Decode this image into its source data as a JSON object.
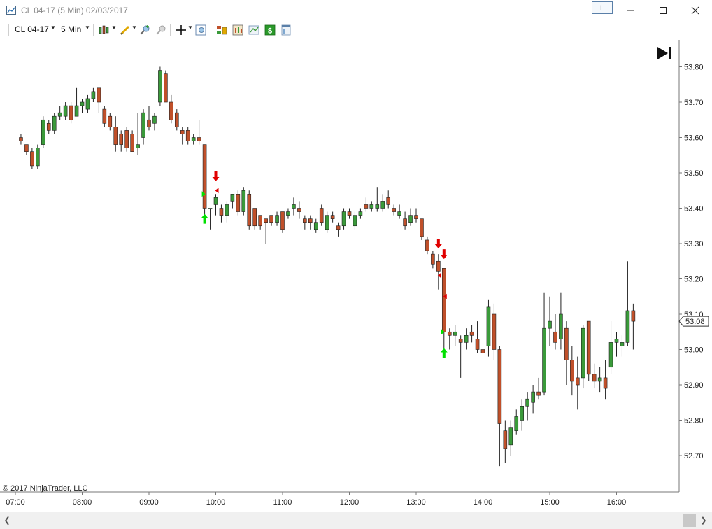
{
  "window": {
    "title": "CL 04-17 (5 Min)  02/03/2017",
    "link_button": "L"
  },
  "toolbar": {
    "instrument": "CL 04-17",
    "interval": "5 Min"
  },
  "chart": {
    "copyright": "© 2017 NinjaTrader, LLC",
    "last_price_label": "53.08",
    "colors": {
      "up": "#3a9a3a",
      "down": "#c0502a",
      "wick": "#222222",
      "buy": "#00e000",
      "sell": "#e00000"
    }
  },
  "chart_data": {
    "type": "candlestick",
    "symbol": "CL 04-17",
    "interval": "5 Min",
    "date": "02/03/2017",
    "y_ticks": [
      53.8,
      53.7,
      53.6,
      53.5,
      53.4,
      53.3,
      53.2,
      53.1,
      53.0,
      52.9,
      52.8,
      52.7
    ],
    "x_ticks": [
      "07:00",
      "08:00",
      "09:00",
      "10:00",
      "11:00",
      "12:00",
      "13:00",
      "14:00",
      "15:00",
      "16:00"
    ],
    "last_price": 53.08,
    "candles": [
      [
        "07:05",
        53.6,
        53.61,
        53.58,
        53.59
      ],
      [
        "07:10",
        53.58,
        53.58,
        53.55,
        53.56
      ],
      [
        "07:15",
        53.56,
        53.57,
        53.51,
        53.52
      ],
      [
        "07:20",
        53.52,
        53.58,
        53.51,
        53.57
      ],
      [
        "07:25",
        53.58,
        53.66,
        53.57,
        53.65
      ],
      [
        "07:30",
        53.64,
        53.65,
        53.61,
        53.62
      ],
      [
        "07:35",
        53.62,
        53.67,
        53.61,
        53.66
      ],
      [
        "07:40",
        53.66,
        53.69,
        53.65,
        53.67
      ],
      [
        "07:45",
        53.66,
        53.7,
        53.65,
        53.69
      ],
      [
        "07:50",
        53.69,
        53.7,
        53.64,
        53.65
      ],
      [
        "07:55",
        53.66,
        53.74,
        53.66,
        53.69
      ],
      [
        "08:00",
        53.69,
        53.71,
        53.67,
        53.7
      ],
      [
        "08:05",
        53.68,
        53.72,
        53.67,
        53.71
      ],
      [
        "08:10",
        53.71,
        53.74,
        53.7,
        53.73
      ],
      [
        "08:15",
        53.74,
        53.74,
        53.67,
        53.7
      ],
      [
        "08:20",
        53.68,
        53.69,
        53.63,
        53.64
      ],
      [
        "08:25",
        53.66,
        53.67,
        53.62,
        53.63
      ],
      [
        "08:30",
        53.63,
        53.66,
        53.56,
        53.58
      ],
      [
        "08:35",
        53.61,
        53.62,
        53.56,
        53.58
      ],
      [
        "08:40",
        53.62,
        53.63,
        53.56,
        53.57
      ],
      [
        "08:45",
        53.61,
        53.62,
        53.56,
        53.56
      ],
      [
        "08:50",
        53.57,
        53.67,
        53.55,
        53.58
      ],
      [
        "08:55",
        53.6,
        53.68,
        53.58,
        53.67
      ],
      [
        "09:00",
        53.65,
        53.69,
        53.62,
        53.63
      ],
      [
        "09:05",
        53.64,
        53.67,
        53.62,
        53.66
      ],
      [
        "09:10",
        53.7,
        53.8,
        53.69,
        53.79
      ],
      [
        "09:15",
        53.78,
        53.79,
        53.7,
        53.7
      ],
      [
        "09:20",
        53.7,
        53.72,
        53.64,
        53.65
      ],
      [
        "09:25",
        53.67,
        53.68,
        53.62,
        53.63
      ],
      [
        "09:30",
        53.62,
        53.63,
        53.58,
        53.61
      ],
      [
        "09:35",
        53.62,
        53.63,
        53.58,
        53.59
      ],
      [
        "09:40",
        53.59,
        53.61,
        53.58,
        53.6
      ],
      [
        "09:45",
        53.6,
        53.65,
        53.58,
        53.59
      ],
      [
        "09:50",
        53.58,
        53.58,
        53.38,
        53.4
      ],
      [
        "09:55",
        53.4,
        53.4,
        53.34,
        53.4
      ],
      [
        "10:00",
        53.41,
        53.44,
        53.38,
        53.43
      ],
      [
        "10:05",
        53.4,
        53.41,
        53.36,
        53.38
      ],
      [
        "10:10",
        53.38,
        53.42,
        53.36,
        53.41
      ],
      [
        "10:15",
        53.42,
        53.43,
        53.4,
        53.44
      ],
      [
        "10:20",
        53.44,
        53.45,
        53.38,
        53.39
      ],
      [
        "10:25",
        53.39,
        53.46,
        53.38,
        53.45
      ],
      [
        "10:30",
        53.44,
        53.45,
        53.34,
        53.35
      ],
      [
        "10:35",
        53.4,
        53.4,
        53.34,
        53.35
      ],
      [
        "10:40",
        53.38,
        53.38,
        53.34,
        53.35
      ],
      [
        "10:45",
        53.37,
        53.37,
        53.3,
        53.36
      ],
      [
        "10:50",
        53.38,
        53.38,
        53.35,
        53.36
      ],
      [
        "10:55",
        53.36,
        53.39,
        53.35,
        53.38
      ],
      [
        "11:00",
        53.39,
        53.39,
        53.33,
        53.34
      ],
      [
        "11:05",
        53.38,
        53.4,
        53.37,
        53.39
      ],
      [
        "11:10",
        53.4,
        53.43,
        53.38,
        53.41
      ],
      [
        "11:15",
        53.4,
        53.42,
        53.37,
        53.39
      ],
      [
        "11:20",
        53.37,
        53.38,
        53.34,
        53.36
      ],
      [
        "11:25",
        53.37,
        53.38,
        53.34,
        53.36
      ],
      [
        "11:30",
        53.34,
        53.37,
        53.33,
        53.36
      ],
      [
        "11:35",
        53.4,
        53.41,
        53.35,
        53.36
      ],
      [
        "11:40",
        53.34,
        53.39,
        53.33,
        53.38
      ],
      [
        "11:45",
        53.38,
        53.39,
        53.36,
        53.37
      ],
      [
        "11:50",
        53.35,
        53.36,
        53.32,
        53.34
      ],
      [
        "11:55",
        53.35,
        53.4,
        53.34,
        53.39
      ],
      [
        "12:00",
        53.39,
        53.4,
        53.37,
        53.38
      ],
      [
        "12:05",
        53.35,
        53.39,
        53.34,
        53.38
      ],
      [
        "12:10",
        53.38,
        53.4,
        53.37,
        53.39
      ],
      [
        "12:15",
        53.41,
        53.43,
        53.39,
        53.4
      ],
      [
        "12:20",
        53.4,
        53.42,
        53.39,
        53.41
      ],
      [
        "12:25",
        53.4,
        53.46,
        53.39,
        53.41
      ],
      [
        "12:30",
        53.4,
        53.44,
        53.39,
        53.42
      ],
      [
        "12:35",
        53.43,
        53.45,
        53.4,
        53.41
      ],
      [
        "12:40",
        53.4,
        53.41,
        53.38,
        53.39
      ],
      [
        "12:45",
        53.38,
        53.41,
        53.37,
        53.39
      ],
      [
        "12:50",
        53.37,
        53.39,
        53.34,
        53.35
      ],
      [
        "12:55",
        53.36,
        53.4,
        53.35,
        53.38
      ],
      [
        "13:00",
        53.38,
        53.4,
        53.36,
        53.37
      ],
      [
        "13:05",
        53.37,
        53.37,
        53.31,
        53.32
      ],
      [
        "13:10",
        53.31,
        53.32,
        53.27,
        53.28
      ],
      [
        "13:15",
        53.27,
        53.28,
        53.23,
        53.24
      ],
      [
        "13:20",
        53.25,
        53.27,
        53.17,
        53.22
      ],
      [
        "13:25",
        53.23,
        53.23,
        53.0,
        53.05
      ],
      [
        "13:30",
        53.05,
        53.06,
        53.0,
        53.04
      ],
      [
        "13:35",
        53.04,
        53.07,
        53.01,
        53.05
      ],
      [
        "13:40",
        53.03,
        53.04,
        52.92,
        53.02
      ],
      [
        "13:45",
        53.02,
        53.06,
        53.0,
        53.04
      ],
      [
        "13:50",
        53.05,
        53.07,
        53.02,
        53.04
      ],
      [
        "13:55",
        53.03,
        53.08,
        52.99,
        53.0
      ],
      [
        "14:00",
        53.0,
        53.03,
        52.97,
        52.99
      ],
      [
        "14:05",
        53.01,
        53.14,
        52.98,
        53.12
      ],
      [
        "14:10",
        53.1,
        53.13,
        52.97,
        53.0
      ],
      [
        "14:15",
        53.0,
        53.01,
        52.67,
        52.79
      ],
      [
        "14:20",
        52.77,
        52.8,
        52.68,
        52.72
      ],
      [
        "14:25",
        52.73,
        52.8,
        52.7,
        52.78
      ],
      [
        "14:30",
        52.77,
        52.83,
        52.76,
        52.81
      ],
      [
        "14:35",
        52.8,
        52.86,
        52.77,
        52.84
      ],
      [
        "14:40",
        52.84,
        52.88,
        52.8,
        52.86
      ],
      [
        "14:45",
        52.85,
        52.9,
        52.82,
        52.88
      ],
      [
        "14:50",
        52.88,
        52.92,
        52.86,
        52.87
      ],
      [
        "14:55",
        52.88,
        53.16,
        52.87,
        53.06
      ],
      [
        "15:00",
        53.06,
        53.15,
        53.01,
        53.08
      ],
      [
        "15:05",
        53.05,
        53.1,
        53.0,
        53.02
      ],
      [
        "15:10",
        53.03,
        53.16,
        53.0,
        53.1
      ],
      [
        "15:15",
        53.06,
        53.08,
        52.9,
        52.97
      ],
      [
        "15:20",
        52.97,
        53.01,
        52.87,
        52.91
      ],
      [
        "15:25",
        52.92,
        52.98,
        52.83,
        52.9
      ],
      [
        "15:30",
        52.92,
        53.07,
        52.89,
        53.06
      ],
      [
        "15:35",
        53.08,
        53.08,
        52.91,
        52.93
      ],
      [
        "15:40",
        52.93,
        52.96,
        52.89,
        52.91
      ],
      [
        "15:45",
        52.91,
        52.95,
        52.88,
        52.92
      ],
      [
        "15:50",
        52.92,
        52.97,
        52.86,
        52.89
      ],
      [
        "15:55",
        52.95,
        53.08,
        52.93,
        53.02
      ],
      [
        "16:00",
        53.02,
        53.05,
        52.98,
        53.03
      ],
      [
        "16:05",
        53.01,
        53.04,
        52.98,
        53.02
      ],
      [
        "16:10",
        53.02,
        53.25,
        53.01,
        53.11
      ],
      [
        "16:15",
        53.11,
        53.13,
        53.0,
        53.08
      ]
    ],
    "buy_arrows": [
      [
        "09:50",
        53.37
      ],
      [
        "13:25",
        52.99
      ]
    ],
    "sell_arrows": [
      [
        "10:00",
        53.49
      ],
      [
        "13:20",
        53.3
      ],
      [
        "13:25",
        53.27
      ]
    ],
    "buy_triangles": [
      [
        "09:50",
        53.44
      ],
      [
        "13:25",
        53.05
      ]
    ],
    "sell_triangles": [
      [
        "10:00",
        53.45
      ],
      [
        "13:20",
        53.21
      ],
      [
        "13:25",
        53.15
      ]
    ]
  }
}
